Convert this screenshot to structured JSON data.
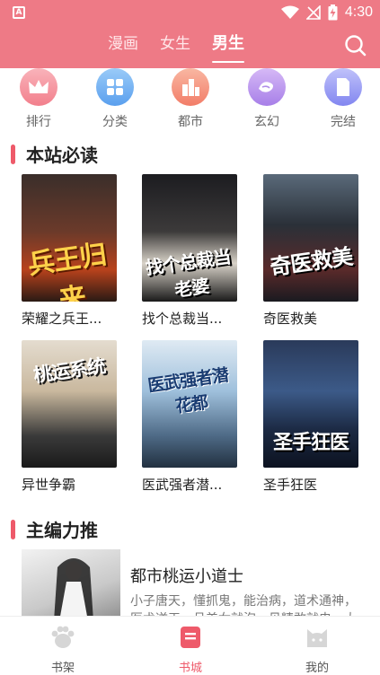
{
  "status_bar": {
    "time": "4:30"
  },
  "top_nav": {
    "tabs": [
      {
        "label": "漫画"
      },
      {
        "label": "女生"
      },
      {
        "label": "男生"
      }
    ],
    "active_tab": "男生"
  },
  "categories": [
    {
      "label": "排行",
      "icon": "crown-icon",
      "color": "#f7a0a8"
    },
    {
      "label": "分类",
      "icon": "grid-icon",
      "color": "#7ab8f5"
    },
    {
      "label": "都市",
      "icon": "city-icon",
      "color": "#f6a38a"
    },
    {
      "label": "玄幻",
      "icon": "fantasy-icon",
      "color": "#c6a3f0"
    },
    {
      "label": "完结",
      "icon": "book-icon",
      "color": "#a5a8f6"
    }
  ],
  "sections": {
    "must_read": {
      "title": "本站必读",
      "books": [
        {
          "name": "荣耀之兵王...",
          "cover_text": "兵王归来"
        },
        {
          "name": "找个总裁当...",
          "cover_text": "找个总裁当老婆"
        },
        {
          "name": "奇医救美",
          "cover_text": "奇医救美"
        },
        {
          "name": "异世争霸",
          "cover_text": "桃运系统"
        },
        {
          "name": "医武强者潜...",
          "cover_text": "医武强者潜花都"
        },
        {
          "name": "圣手狂医",
          "cover_text": "圣手狂医"
        }
      ]
    },
    "editor_pick": {
      "title": "主编力推",
      "book": {
        "title": "都市桃运小道士",
        "desc": "小子唐天，懂抓鬼，能治病，道术通神，医术逆天，且美女就泡，见精敢就虫，大"
      }
    }
  },
  "bottom_bar": {
    "items": [
      {
        "label": "书架"
      },
      {
        "label": "书城"
      },
      {
        "label": "我的"
      }
    ],
    "active": "书城"
  }
}
